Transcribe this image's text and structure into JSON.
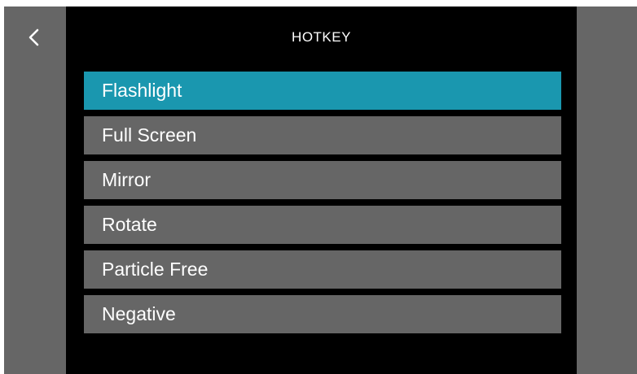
{
  "header": {
    "title": "HOTKEY",
    "back_icon": "chevron-left-icon"
  },
  "menu": {
    "selected_index": 0,
    "items": [
      {
        "label": "Flashlight"
      },
      {
        "label": "Full Screen"
      },
      {
        "label": "Mirror"
      },
      {
        "label": "Rotate"
      },
      {
        "label": "Particle Free"
      },
      {
        "label": "Negative"
      }
    ]
  },
  "colors": {
    "background": "#000000",
    "side_panel": "#666666",
    "item": "#666666",
    "item_selected": "#1a97af",
    "text": "#ffffff"
  }
}
